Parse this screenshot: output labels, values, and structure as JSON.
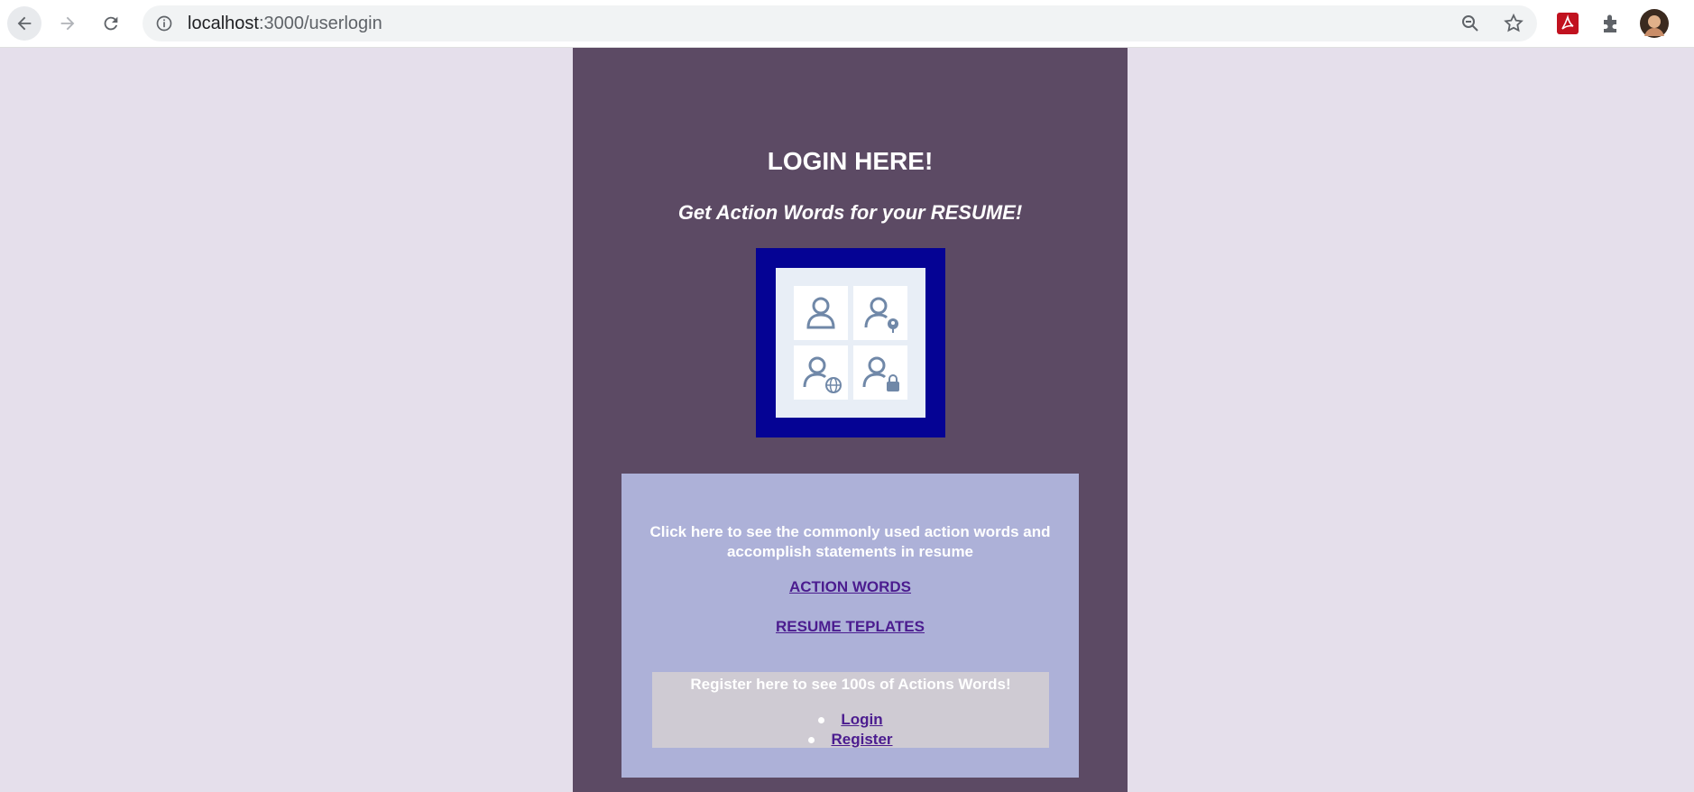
{
  "browser": {
    "url_host": "localhost",
    "url_rest": ":3000/userlogin",
    "icons": [
      "back-icon",
      "forward-icon",
      "reload-icon",
      "site-info-icon",
      "zoom-icon",
      "bookmark-star-icon",
      "pdf-extension-icon",
      "extensions-puzzle-icon",
      "profile-avatar"
    ]
  },
  "page": {
    "title": "LOGIN HERE!",
    "subtitle": "Get Action Words for your RESUME!",
    "card": {
      "description": "Click here to see the commonly used action words and accomplish statements in resume",
      "links": [
        "ACTION WORDS",
        "RESUME TEPLATES"
      ],
      "register_prompt": "Register here to see 100s of Actions Words!",
      "auth_links": [
        "Login",
        "Register"
      ]
    }
  },
  "colors": {
    "background": "#e5dfeb",
    "column": "#5c4a64",
    "card": "#adb1d8",
    "register_box": "#cfcbd3",
    "link": "#4b1c8f",
    "logo_frame": "#050394"
  }
}
